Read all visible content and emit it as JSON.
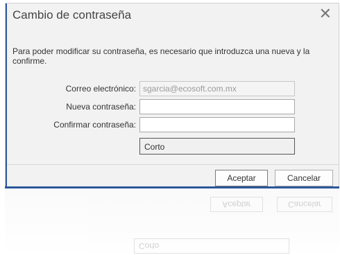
{
  "window": {
    "title": "Cambio de contraseña",
    "close_glyph": "✕"
  },
  "message": "Para poder modificar su contraseña, es necesario que introduzca una nueva y la confirme.",
  "form": {
    "email": {
      "label": "Correo electrónico:",
      "value": "sgarcia@ecosoft.com.mx",
      "disabled": true
    },
    "new_password": {
      "label": "Nueva contraseña:",
      "value": ""
    },
    "confirm_password": {
      "label": "Confirmar contraseña:",
      "value": ""
    },
    "strength": "Corto"
  },
  "buttons": {
    "ok": "Aceptar",
    "cancel": "Cancelar"
  },
  "colors": {
    "accent": "#2b579a",
    "dialog_bg": "#f2f2f2"
  },
  "icons": {
    "close": "close-icon"
  }
}
